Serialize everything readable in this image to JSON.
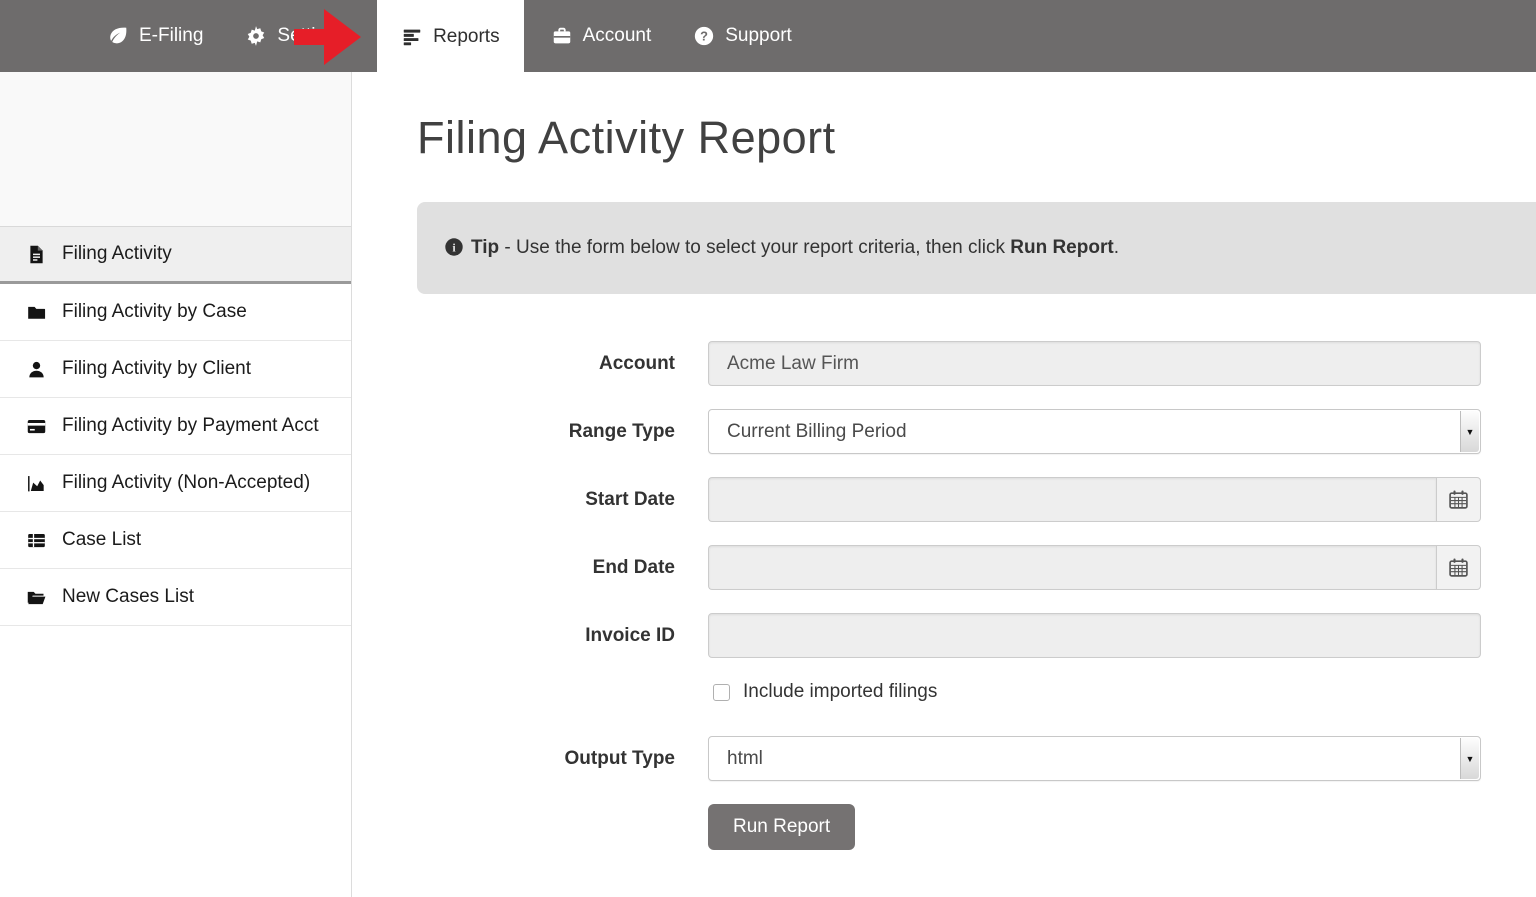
{
  "nav": {
    "items": [
      {
        "label": "E-Filing",
        "icon": "leaf-icon",
        "active": false
      },
      {
        "label": "Settings",
        "icon": "gear-icon",
        "active": false
      },
      {
        "label": "Reports",
        "icon": "report-bars-icon",
        "active": true
      },
      {
        "label": "Account",
        "icon": "briefcase-icon",
        "active": false
      },
      {
        "label": "Support",
        "icon": "question-circle-icon",
        "active": false
      }
    ]
  },
  "annotation": {
    "arrow": {
      "color": "#e61e28",
      "direction": "right",
      "points_to": "Reports"
    }
  },
  "sidebar": {
    "items": [
      {
        "label": "Filing Activity",
        "icon": "file-text-icon",
        "active": true
      },
      {
        "label": "Filing Activity by Case",
        "icon": "folder-icon",
        "active": false
      },
      {
        "label": "Filing Activity by Client",
        "icon": "user-icon",
        "active": false
      },
      {
        "label": "Filing Activity by Payment Acct",
        "icon": "credit-card-icon",
        "active": false
      },
      {
        "label": "Filing Activity (Non-Accepted)",
        "icon": "area-chart-icon",
        "active": false
      },
      {
        "label": "Case List",
        "icon": "table-list-icon",
        "active": false
      },
      {
        "label": "New Cases List",
        "icon": "folder-open-icon",
        "active": false
      }
    ]
  },
  "main": {
    "title": "Filing Activity Report"
  },
  "tip": {
    "icon": "info-circle-icon",
    "label": "Tip",
    "body": " - Use the form below to select your report criteria, then click ",
    "emphasis": "Run Report",
    "suffix": "."
  },
  "form": {
    "account": {
      "label": "Account",
      "value": "Acme Law Firm"
    },
    "range_type": {
      "label": "Range Type",
      "value": "Current Billing Period"
    },
    "start_date": {
      "label": "Start Date",
      "value": ""
    },
    "end_date": {
      "label": "End Date",
      "value": ""
    },
    "invoice_id": {
      "label": "Invoice ID",
      "value": ""
    },
    "include_imported": {
      "label": "Include imported filings",
      "checked": false
    },
    "output_type": {
      "label": "Output Type",
      "value": "html"
    },
    "run_report_label": "Run Report"
  },
  "colors": {
    "navbar_bg": "#6e6c6c",
    "arrow_red": "#e61e28",
    "tip_bg": "#e0e0e0",
    "button_bg": "#757272",
    "disabled_input_bg": "#eeeeee",
    "sidebar_active_bg": "#efefef"
  }
}
